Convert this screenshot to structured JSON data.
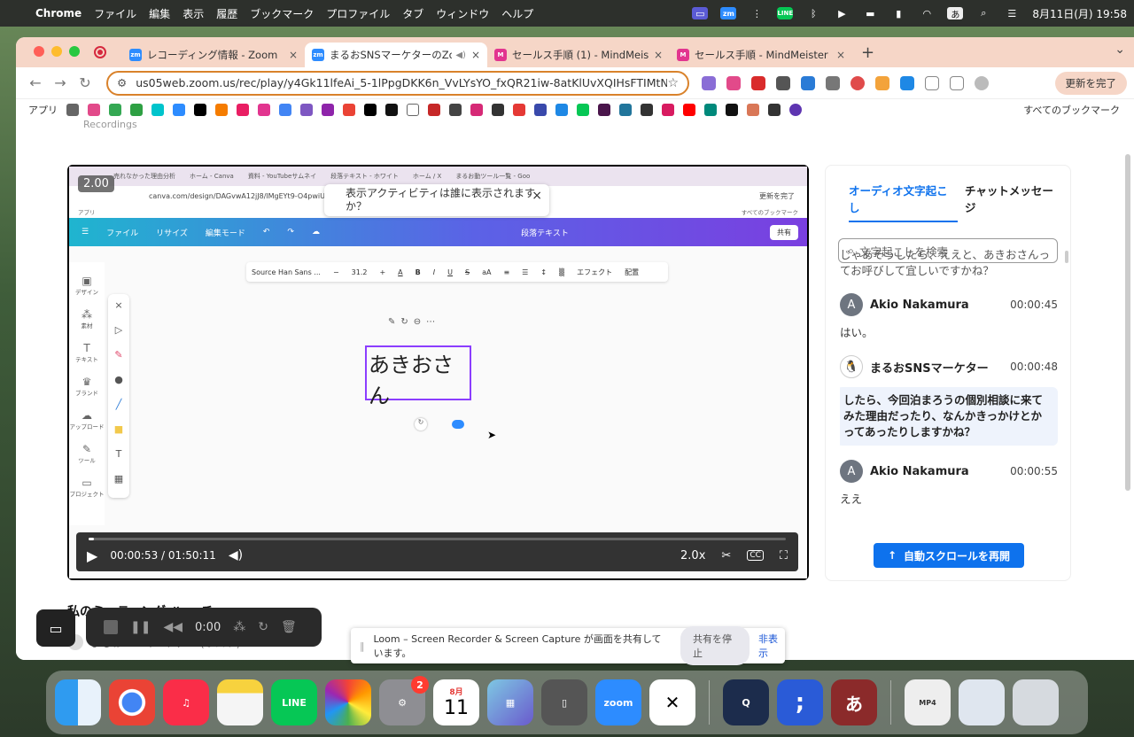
{
  "menubar": {
    "app": "Chrome",
    "items": [
      "ファイル",
      "編集",
      "表示",
      "履歴",
      "ブックマーク",
      "プロファイル",
      "タブ",
      "ウィンドウ",
      "ヘルプ"
    ],
    "clock": "8月11日(月) 19:58",
    "input_mode": "あ",
    "zoom_icon": "zm",
    "line_icon": "LINE"
  },
  "tabs": [
    {
      "icon": "zm",
      "title": "レコーディング情報 - Zoom"
    },
    {
      "icon": "zm",
      "title": "まるおSNSマーケターのZoom"
    },
    {
      "icon": "M",
      "title": "セールス手順 (1) - MindMeister"
    },
    {
      "icon": "M",
      "title": "セールス手順 - MindMeister マ"
    }
  ],
  "url": "us05web.zoom.us/rec/play/y4Gk11lfeAi_5-1lPpgDKK6n_VvLYsYO_fxQR21iw-8atKlUvXQIHsFTIMtNi_...",
  "update_button": "更新を完了",
  "bookmarks": {
    "apps": "アプリ",
    "all": "すべてのブックマーク"
  },
  "crumb": "Recordings",
  "player": {
    "speed_badge": "2.00",
    "current": "00:00:53",
    "separator": "/",
    "total": "01:50:11",
    "rate": "2.0x",
    "cc": "CC",
    "progress": 0.008
  },
  "inner": {
    "tabs": [
      "売れなかった理由分析",
      "ホーム - Canva",
      "資料 - YouTubeサムネイ",
      "段落テキスト - ホワイト",
      "ホーム / X",
      "まるお動ツール一覧 - Goo"
    ],
    "addr": "canva.com/design/DAGvwA12jJ8/lMgEYt9-O4pwiUa",
    "notify": "表示アクティビティは誰に表示されますか？",
    "bar_items": [
      "ファイル",
      "リサイズ",
      "編集モード"
    ],
    "bar_right": "段落テキスト",
    "share": "共有",
    "side": [
      "デザイン",
      "素材",
      "テキスト",
      "ブランド",
      "アップロード",
      "ツール",
      "プロジェクト"
    ],
    "font": "Source Han Sans ...",
    "font_size": "31.2",
    "effect": "エフェクト",
    "align": "配置",
    "text": "あきおさん",
    "update": "更新を完了",
    "bm_apps": "アプリ",
    "bm_all": "すべてのブックマーク"
  },
  "transcript": {
    "tab_audio": "オーディオ文字起こし",
    "tab_chat": "チャットメッセージ",
    "search_placeholder": "文字起こしを検索",
    "cont_text": "じゃあそうしたら、ええと、あきおさんってお呼びして宜しいですかね？",
    "entries": [
      {
        "initial": "A",
        "name": "Akio Nakamura",
        "time": "00:00:45",
        "text": "はい。"
      },
      {
        "initial": "",
        "name": "まるおSNSマーケター",
        "time": "00:00:48",
        "text": "したら、今回泊まろうの個別相談に来てみた理由だったり、なんかきっかけとかってあったりしますかね？"
      },
      {
        "initial": "A",
        "name": "Akio Nakamura",
        "time": "00:00:55",
        "text": "ええ"
      }
    ],
    "resume": "自動スクロールを再開"
  },
  "below": {
    "title": "私のミーティング ハ... チ",
    "host": "まるおSNSマーケター (ホスト)"
  },
  "loom": {
    "time": "0:00"
  },
  "share_bar": {
    "message": "Loom – Screen Recorder & Screen Capture が画面を共有しています。",
    "stop": "共有を停止",
    "hide": "非表示"
  },
  "dock": {
    "calendar_month": "8月",
    "calendar_day": "11",
    "settings_badge": "2",
    "zoom_label": "zoom",
    "line_label": "LINE",
    "mp4_label": "MP4",
    "kana": "あ"
  }
}
